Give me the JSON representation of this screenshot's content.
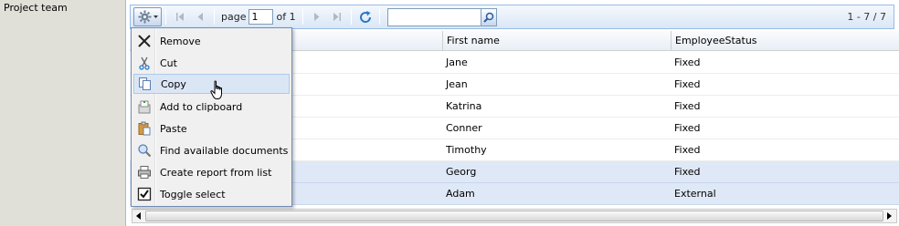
{
  "field": {
    "label": "Project team"
  },
  "toolbar": {
    "page_label": "page",
    "page_value": "1",
    "of_label": "of 1",
    "record_count": "1 - 7 / 7",
    "search_value": ""
  },
  "columns": [
    "First name",
    "EmployeeStatus"
  ],
  "rows": [
    {
      "first_name": "Jane",
      "status": "Fixed",
      "selected": false
    },
    {
      "first_name": "Jean",
      "status": "Fixed",
      "selected": false
    },
    {
      "first_name": "Katrina",
      "status": "Fixed",
      "selected": false
    },
    {
      "first_name": "Conner",
      "status": "Fixed",
      "selected": false
    },
    {
      "first_name": "Timothy",
      "status": "Fixed",
      "selected": false
    },
    {
      "first_name": "Georg",
      "status": "Fixed",
      "selected": true
    },
    {
      "first_name": "Adam",
      "status": "External",
      "selected": true
    }
  ],
  "menu": {
    "items": [
      {
        "label": "Remove",
        "icon": "remove-icon"
      },
      {
        "label": "Cut",
        "icon": "scissors-icon"
      },
      {
        "label": "Copy",
        "icon": "copy-icon",
        "active": true
      },
      {
        "label": "Add to clipboard",
        "icon": "add-to-clipboard-icon"
      },
      {
        "label": "Paste",
        "icon": "paste-icon"
      },
      {
        "label": "Find available documents",
        "icon": "magnifier-icon"
      },
      {
        "label": "Create report from list",
        "icon": "printer-icon"
      },
      {
        "label": "Toggle select",
        "icon": "checkbox-icon"
      }
    ]
  },
  "colors": {
    "selected_row": "#dfe8f6",
    "toolbar_border": "#99bbe8",
    "menu_highlight": "#dbe6f5"
  }
}
